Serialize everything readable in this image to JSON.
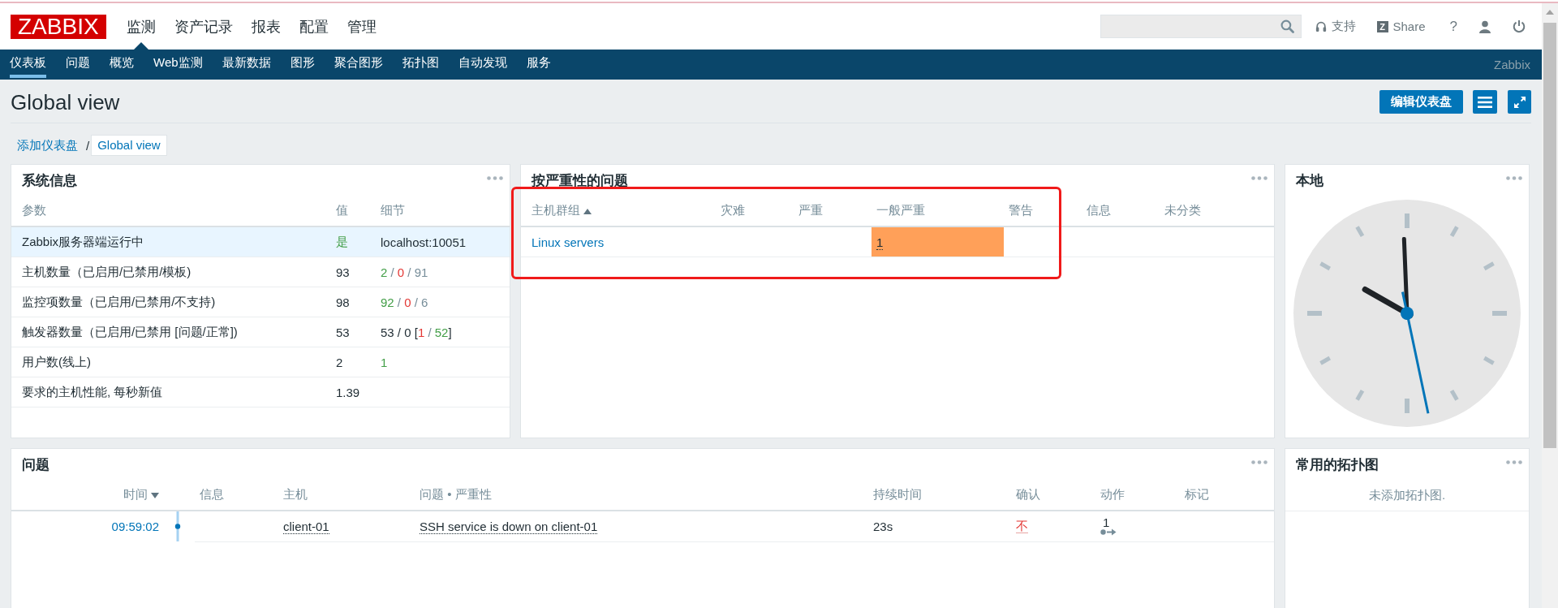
{
  "header": {
    "logo": "ZABBIX",
    "main_nav": [
      {
        "label": "监测",
        "selected": true
      },
      {
        "label": "资产记录",
        "selected": false
      },
      {
        "label": "报表",
        "selected": false
      },
      {
        "label": "配置",
        "selected": false
      },
      {
        "label": "管理",
        "selected": false
      }
    ],
    "tools": [
      {
        "kind": "support",
        "label": "支持"
      },
      {
        "kind": "share",
        "badge": "Z",
        "label": "Share"
      },
      {
        "kind": "help",
        "label": "?"
      },
      {
        "kind": "profile"
      },
      {
        "kind": "logout"
      }
    ]
  },
  "sub_nav": {
    "items": [
      {
        "label": "仪表板",
        "selected": true
      },
      {
        "label": "问题",
        "selected": false
      },
      {
        "label": "概览",
        "selected": false
      },
      {
        "label": "Web监测",
        "selected": false
      },
      {
        "label": "最新数据",
        "selected": false
      },
      {
        "label": "图形",
        "selected": false
      },
      {
        "label": "聚合图形",
        "selected": false
      },
      {
        "label": "拓扑图",
        "selected": false
      },
      {
        "label": "自动发现",
        "selected": false
      },
      {
        "label": "服务",
        "selected": false
      }
    ],
    "server_name": "Zabbix"
  },
  "page": {
    "title": "Global view",
    "actions": [
      {
        "kind": "edit",
        "label": "编辑仪表盘"
      },
      {
        "kind": "menu"
      },
      {
        "kind": "fullscreen"
      }
    ],
    "breadcrumbs": [
      {
        "label": "添加仪表盘",
        "selected": false
      },
      {
        "label": "Global view",
        "selected": true
      }
    ],
    "breadcrumb_separator": "/"
  },
  "system_info": {
    "title": "系统信息",
    "columns": [
      "参数",
      "值",
      "细节"
    ],
    "rows": [
      {
        "parameter": "Zabbix服务器端运行中",
        "value": "是",
        "value_ok": true,
        "details": [
          {
            "text": "localhost:10051",
            "kind": "plain"
          }
        ],
        "hovered": true
      },
      {
        "parameter": "主机数量（已启用/已禁用/模板)",
        "value": "93",
        "value_ok": false,
        "details": [
          {
            "text": "2",
            "kind": "ok"
          },
          {
            "text": " / ",
            "kind": "muted"
          },
          {
            "text": "0",
            "kind": "problem"
          },
          {
            "text": " / ",
            "kind": "muted"
          },
          {
            "text": "91",
            "kind": "muted"
          }
        ],
        "hovered": false
      },
      {
        "parameter": "监控项数量（已启用/已禁用/不支持)",
        "value": "98",
        "value_ok": false,
        "details": [
          {
            "text": "92",
            "kind": "ok"
          },
          {
            "text": " / ",
            "kind": "muted"
          },
          {
            "text": "0",
            "kind": "problem"
          },
          {
            "text": " / ",
            "kind": "muted"
          },
          {
            "text": "6",
            "kind": "muted"
          }
        ],
        "hovered": false
      },
      {
        "parameter": "触发器数量（已启用/已禁用 [问题/正常])",
        "value": "53",
        "value_ok": false,
        "details": [
          {
            "text": "53 / 0 [",
            "kind": "plain"
          },
          {
            "text": "1",
            "kind": "problem"
          },
          {
            "text": " / ",
            "kind": "muted"
          },
          {
            "text": "52",
            "kind": "ok"
          },
          {
            "text": "]",
            "kind": "plain"
          }
        ],
        "hovered": false
      },
      {
        "parameter": "用户数(线上)",
        "value": "2",
        "value_ok": false,
        "details": [
          {
            "text": "1",
            "kind": "ok"
          }
        ],
        "hovered": false
      },
      {
        "parameter": "要求的主机性能, 每秒新值",
        "value": "1.39",
        "value_ok": false,
        "hovered": false
      }
    ]
  },
  "problems_by_severity": {
    "title": "按严重性的问题",
    "annotation_frame": true,
    "columns": [
      {
        "label": "主机群组",
        "sorted": true,
        "descending": false
      },
      {
        "label": "灾难",
        "kind": "disaster",
        "sorted": false
      },
      {
        "label": "严重",
        "kind": "high",
        "sorted": false
      },
      {
        "label": "一般严重",
        "kind": "average",
        "sorted": false
      },
      {
        "label": "警告",
        "kind": "warning",
        "sorted": false
      },
      {
        "label": "信息",
        "kind": "information",
        "sorted": false
      },
      {
        "label": "未分类",
        "kind": "unclassified",
        "sorted": false
      }
    ],
    "rows": [
      {
        "host_group": "Linux servers",
        "counts": [
          {
            "kind": "average",
            "text": "1",
            "color": "#ffa059"
          }
        ]
      }
    ]
  },
  "clock": {
    "title": "本地"
  },
  "problems": {
    "title": "问题",
    "columns": [
      {
        "label": "时间",
        "sorted": true,
        "descending": true
      },
      {
        "label": "信息",
        "sorted": false
      },
      {
        "label": "主机",
        "sorted": false
      },
      {
        "label": "问题 • 严重性",
        "sorted": false
      },
      {
        "label": "持续时间",
        "sorted": false
      },
      {
        "label": "确认",
        "sorted": false
      },
      {
        "label": "动作",
        "sorted": false
      },
      {
        "label": "标记",
        "sorted": false
      }
    ],
    "rows": [
      {
        "time": "09:59:02",
        "host": "client-01",
        "problem": "SSH service is down on client-01",
        "duration": "23s",
        "ack": "不",
        "acknowledged": false,
        "actions": "1"
      }
    ]
  },
  "maps": {
    "title": "常用的拓扑图",
    "empty_message": "未添加拓扑图."
  }
}
